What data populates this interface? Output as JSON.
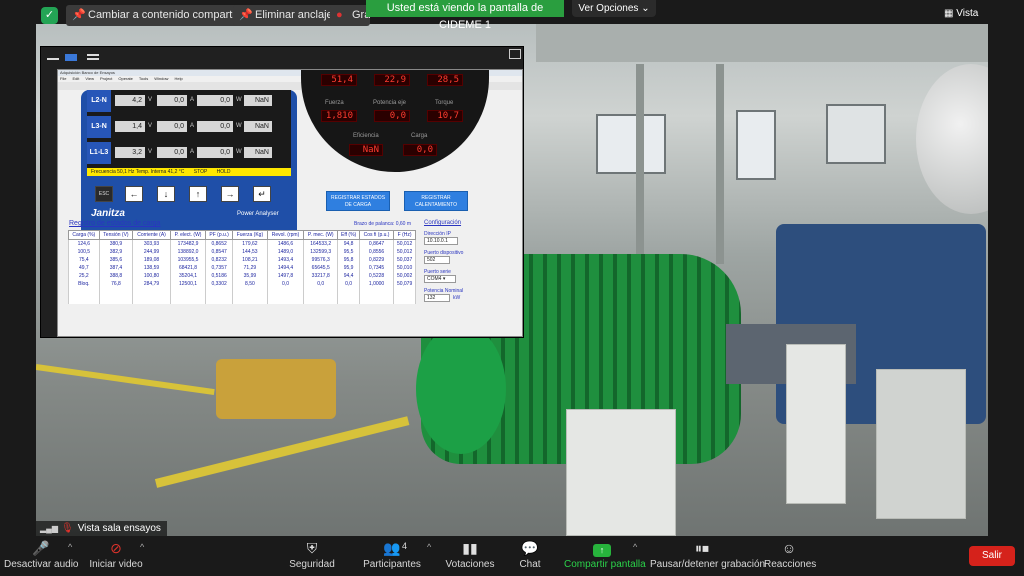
{
  "topbar": {
    "share_change": "Cambiar a contenido compartido",
    "unpin": "Eliminar anclaje",
    "participant_name": "Grabándose",
    "banner": "Usted está viendo la pantalla de CIDEME 1",
    "view_options": "Ver Opciones",
    "view": "Vista"
  },
  "app": {
    "title": "Adquisición Banco de Ensayos",
    "menu": [
      "File",
      "Edit",
      "View",
      "Project",
      "Operate",
      "Tools",
      "Window",
      "Help"
    ],
    "analyser": {
      "rows": [
        {
          "label": "L2-N",
          "v": "4,2",
          "a": "0,0",
          "w": "0,0",
          "x": "NaN"
        },
        {
          "label": "L3-N",
          "v": "1,4",
          "a": "0,0",
          "w": "0,0",
          "x": "NaN"
        },
        {
          "label": "L1-L3",
          "v": "3,2",
          "a": "0,0",
          "w": "0,0",
          "x": "NaN"
        }
      ],
      "unit_v": "V",
      "unit_a": "A",
      "unit_w": "W",
      "status": [
        "Frecuencia",
        "50,1",
        "Hz",
        "Temp. Interna",
        "41,2",
        "°C",
        "STOP",
        "HOLD"
      ],
      "keys": [
        "ESC",
        "←",
        "↓",
        "↑",
        "→",
        "↵"
      ],
      "brand": "Janitza",
      "model": "Power Analyser"
    },
    "dial": {
      "top_values": [
        "51,4",
        "22,9",
        "28,5"
      ],
      "labels": [
        "Fuerza",
        "Potencia eje",
        "Torque",
        "Eficiencia",
        "Carga"
      ],
      "values": [
        "1,810",
        "0,0",
        "10,7",
        "NaN",
        "0,0"
      ]
    },
    "buttons": {
      "register_load": "REGISTRAR ESTADOS DE CARGA",
      "register_heat": "REGISTRAR CALENTAMIENTO"
    },
    "log": {
      "title": "Registro de estados de carga",
      "arm": "Brazo de palanca: 0,60 m",
      "headers": [
        "Carga (%)",
        "Tensión (V)",
        "Corriente (A)",
        "P. elect. (W)",
        "PF (p.u.)",
        "Fuerza (Kg)",
        "Revol. (rpm)",
        "P. mec. (W)",
        "Eff (%)",
        "Cos fi (p.u.)",
        "F (Hz)"
      ],
      "rows": [
        [
          "124,6",
          "380,9",
          "303,93",
          "173482,9",
          "0,8652",
          "179,62",
          "1486,6",
          "164533,2",
          "94,8",
          "0,8647",
          "50,012"
        ],
        [
          "100,5",
          "382,9",
          "244,99",
          "138892,0",
          "0,8547",
          "144,53",
          "1489,0",
          "132599,3",
          "95,5",
          "0,8556",
          "50,012"
        ],
        [
          "75,4",
          "385,6",
          "189,08",
          "103955,5",
          "0,8232",
          "108,21",
          "1493,4",
          "99576,3",
          "95,8",
          "0,8229",
          "50,037"
        ],
        [
          "49,7",
          "387,4",
          "138,59",
          "68421,8",
          "0,7357",
          "71,29",
          "1494,4",
          "65645,5",
          "95,9",
          "0,7345",
          "50,010"
        ],
        [
          "25,2",
          "388,8",
          "100,80",
          "35204,1",
          "0,5186",
          "35,99",
          "1497,8",
          "33217,8",
          "94,4",
          "0,5228",
          "50,002"
        ],
        [
          "Bloq.",
          "76,8",
          "284,79",
          "12500,1",
          "0,3302",
          "8,50",
          "0,0",
          "0,0",
          "0,0",
          "1,0000",
          "50,079"
        ]
      ]
    },
    "config": {
      "title": "Configuración",
      "ip_label": "Dirección IP",
      "ip": "10.10.0.1",
      "port_label": "Puerto dispositivo",
      "port": "502",
      "serial_label": "Puerto serie",
      "serial": "COM4",
      "power_label": "Potencia Nominal",
      "power": "132",
      "power_unit": "kW"
    }
  },
  "nameplate": "Vista sala ensayos",
  "toolbar": {
    "mute": "Desactivar audio",
    "video": "Iniciar video",
    "security": "Seguridad",
    "participants": "Participantes",
    "participants_count": "4",
    "polls": "Votaciones",
    "chat": "Chat",
    "share": "Compartir pantalla",
    "record": "Pausar/detener grabación",
    "reactions": "Reacciones",
    "leave": "Salir"
  },
  "colors": {
    "accent_green": "#2a9e3f",
    "leave_red": "#d5221b",
    "led_red": "#ff3b2f"
  }
}
